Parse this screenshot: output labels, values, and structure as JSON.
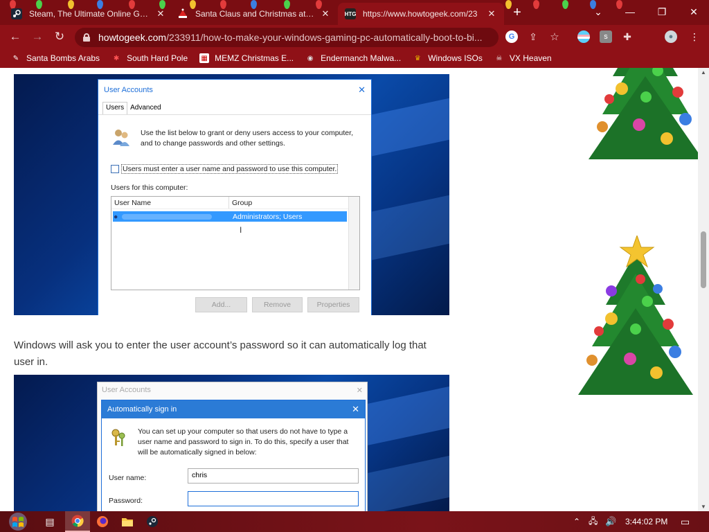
{
  "browser": {
    "tabs": [
      {
        "title": "Steam, The Ultimate Online Gam",
        "icon": "steam-icon",
        "active": false
      },
      {
        "title": "Santa Claus and Christmas at the",
        "icon": "santa-icon",
        "active": false
      },
      {
        "title": "https://www.howtogeek.com/23",
        "icon": "htg-icon",
        "favicon_text": "HTG",
        "active": true
      }
    ],
    "url_host": "howtogeek.com",
    "url_path": "/233911/how-to-make-your-windows-gaming-pc-automatically-boot-to-bi...",
    "bookmarks": [
      {
        "label": "Santa Bombs Arabs",
        "icon": "santa-bookmark-icon"
      },
      {
        "label": "South Hard Pole",
        "icon": "snowflake-icon"
      },
      {
        "label": "MEMZ Christmas E...",
        "icon": "memz-icon"
      },
      {
        "label": "Endermanch Malwa...",
        "icon": "raccoon-icon"
      },
      {
        "label": "Windows ISOs",
        "icon": "windows-isos-icon"
      },
      {
        "label": "VX Heaven",
        "icon": "skull-icon"
      }
    ]
  },
  "article": {
    "paragraph": "Windows will ask you to enter the user account’s password so it can automatically log that user in."
  },
  "user_accounts_dialog": {
    "title": "User Accounts",
    "tabs": [
      "Users",
      "Advanced"
    ],
    "description": "Use the list below to grant or deny users access to your computer, and to change passwords and other settings.",
    "checkbox_label": "Users must enter a user name and password to use this computer.",
    "list_label": "Users for this computer:",
    "columns": [
      "User Name",
      "Group"
    ],
    "row_group": "Administrators; Users",
    "buttons": [
      "Add...",
      "Remove",
      "Properties"
    ]
  },
  "autosign_dialog": {
    "bg_title": "User Accounts",
    "title": "Automatically sign in",
    "description": "You can set up your computer so that users do not have to type a user name and password to sign in. To do this, specify a user that will be automatically signed in below:",
    "username_label": "User name:",
    "username_value": "chris",
    "password_label": "Password:"
  },
  "taskbar": {
    "clock": "3:44:02 PM"
  },
  "colors": {
    "chrome_frame": "#8f1117",
    "tab_strip": "#7a0d12",
    "dialog_accent": "#1e6fd9",
    "selection": "#3399ff"
  }
}
